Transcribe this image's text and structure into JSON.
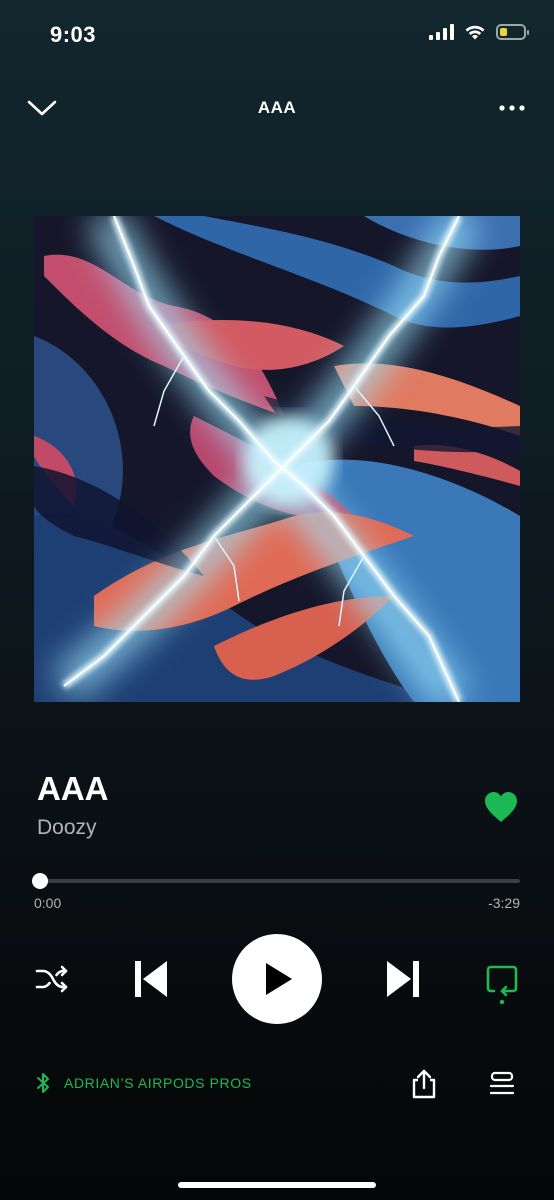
{
  "status_bar": {
    "time": "9:03",
    "signal_icon": "cellular-signal-icon",
    "wifi_icon": "wifi-icon",
    "battery_icon": "battery-low-icon",
    "battery_level": 0.3,
    "battery_color": "#f2d23c"
  },
  "nav": {
    "title": "AAA",
    "collapse_icon": "chevron-down-icon",
    "more_icon": "more-horizontal-icon"
  },
  "track": {
    "title": "AAA",
    "artist": "Doozy",
    "liked": true,
    "heart_icon": "heart-filled-icon"
  },
  "playback": {
    "elapsed": "0:00",
    "remaining": "-3:29",
    "progress": 0.0,
    "state": "paused",
    "shuffle_icon": "shuffle-icon",
    "previous_icon": "skip-previous-icon",
    "play_icon": "play-icon",
    "next_icon": "skip-next-icon",
    "repeat_icon": "repeat-icon",
    "repeat_active": true
  },
  "device": {
    "name": "ADRIAN’S AIRPODS PROS",
    "icon": "bluetooth-icon"
  },
  "actions": {
    "share_icon": "share-icon",
    "queue_icon": "queue-icon"
  },
  "colors": {
    "accent": "#1db954",
    "text_secondary": "#b3b3b3",
    "background_top": "#12262e",
    "background_bottom": "#050607"
  }
}
